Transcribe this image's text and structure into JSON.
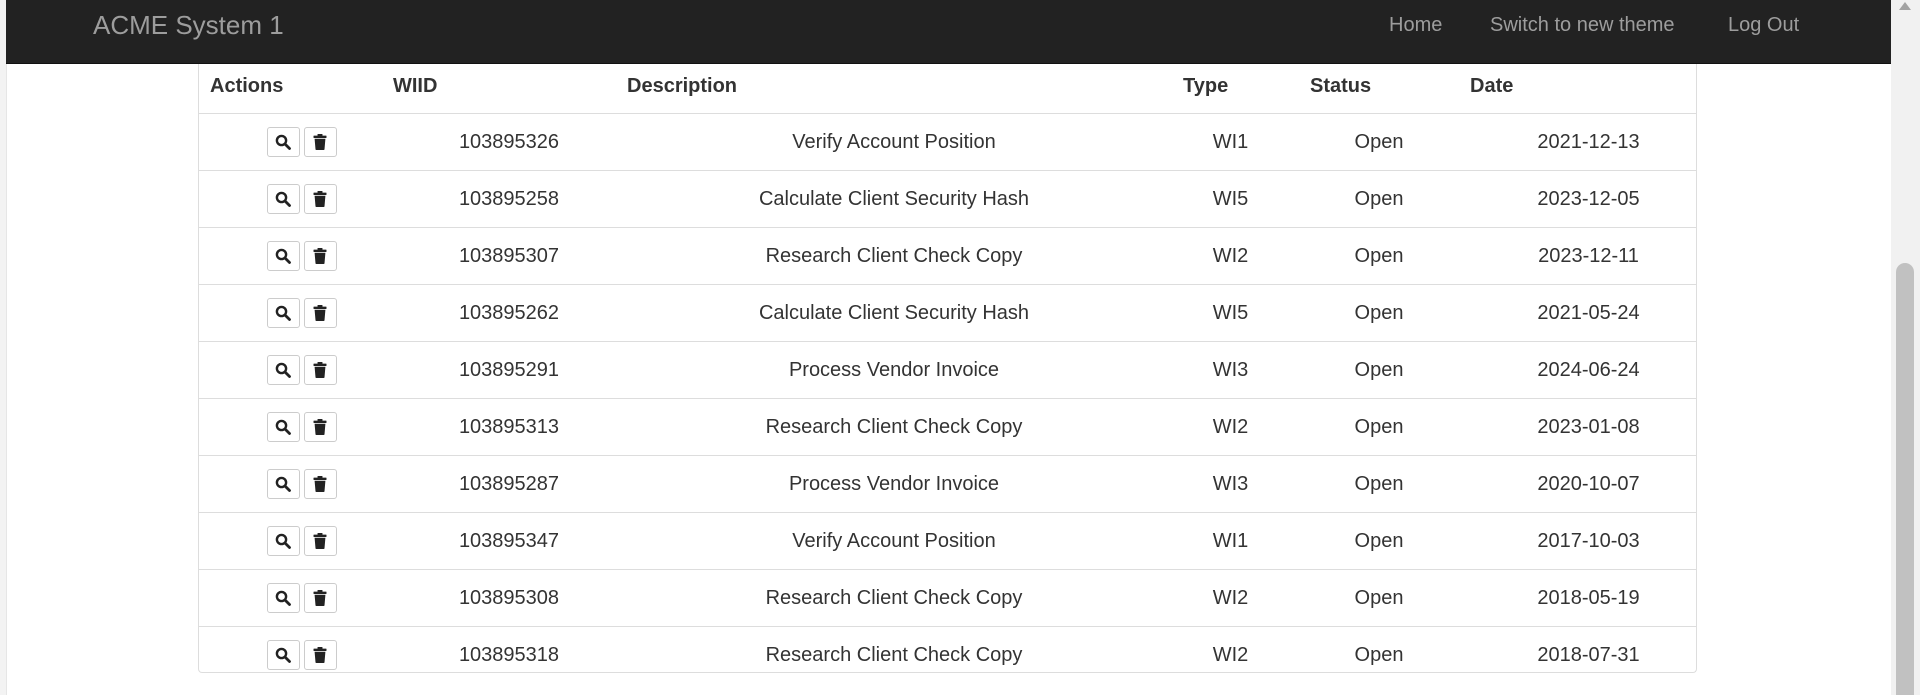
{
  "navbar": {
    "brand": "ACME System 1",
    "links": [
      "Home",
      "Switch to new theme",
      "Log Out"
    ]
  },
  "table": {
    "headers": [
      "Actions",
      "WIID",
      "Description",
      "Type",
      "Status",
      "Date"
    ],
    "rows": [
      {
        "wiid": "103895326",
        "description": "Verify Account Position",
        "type": "WI1",
        "status": "Open",
        "date": "2021-12-13"
      },
      {
        "wiid": "103895258",
        "description": "Calculate Client Security Hash",
        "type": "WI5",
        "status": "Open",
        "date": "2023-12-05"
      },
      {
        "wiid": "103895307",
        "description": "Research Client Check Copy",
        "type": "WI2",
        "status": "Open",
        "date": "2023-12-11"
      },
      {
        "wiid": "103895262",
        "description": "Calculate Client Security Hash",
        "type": "WI5",
        "status": "Open",
        "date": "2021-05-24"
      },
      {
        "wiid": "103895291",
        "description": "Process Vendor Invoice",
        "type": "WI3",
        "status": "Open",
        "date": "2024-06-24"
      },
      {
        "wiid": "103895313",
        "description": "Research Client Check Copy",
        "type": "WI2",
        "status": "Open",
        "date": "2023-01-08"
      },
      {
        "wiid": "103895287",
        "description": "Process Vendor Invoice",
        "type": "WI3",
        "status": "Open",
        "date": "2020-10-07"
      },
      {
        "wiid": "103895347",
        "description": "Verify Account Position",
        "type": "WI1",
        "status": "Open",
        "date": "2017-10-03"
      },
      {
        "wiid": "103895308",
        "description": "Research Client Check Copy",
        "type": "WI2",
        "status": "Open",
        "date": "2018-05-19"
      },
      {
        "wiid": "103895318",
        "description": "Research Client Check Copy",
        "type": "WI2",
        "status": "Open",
        "date": "2018-07-31"
      }
    ],
    "row_icons": [
      "search-icon",
      "trash-icon"
    ]
  },
  "colors": {
    "navbar_bg": "#222222",
    "navbar_text": "#9d9d9d",
    "border": "#dddddd",
    "text": "#333333"
  }
}
